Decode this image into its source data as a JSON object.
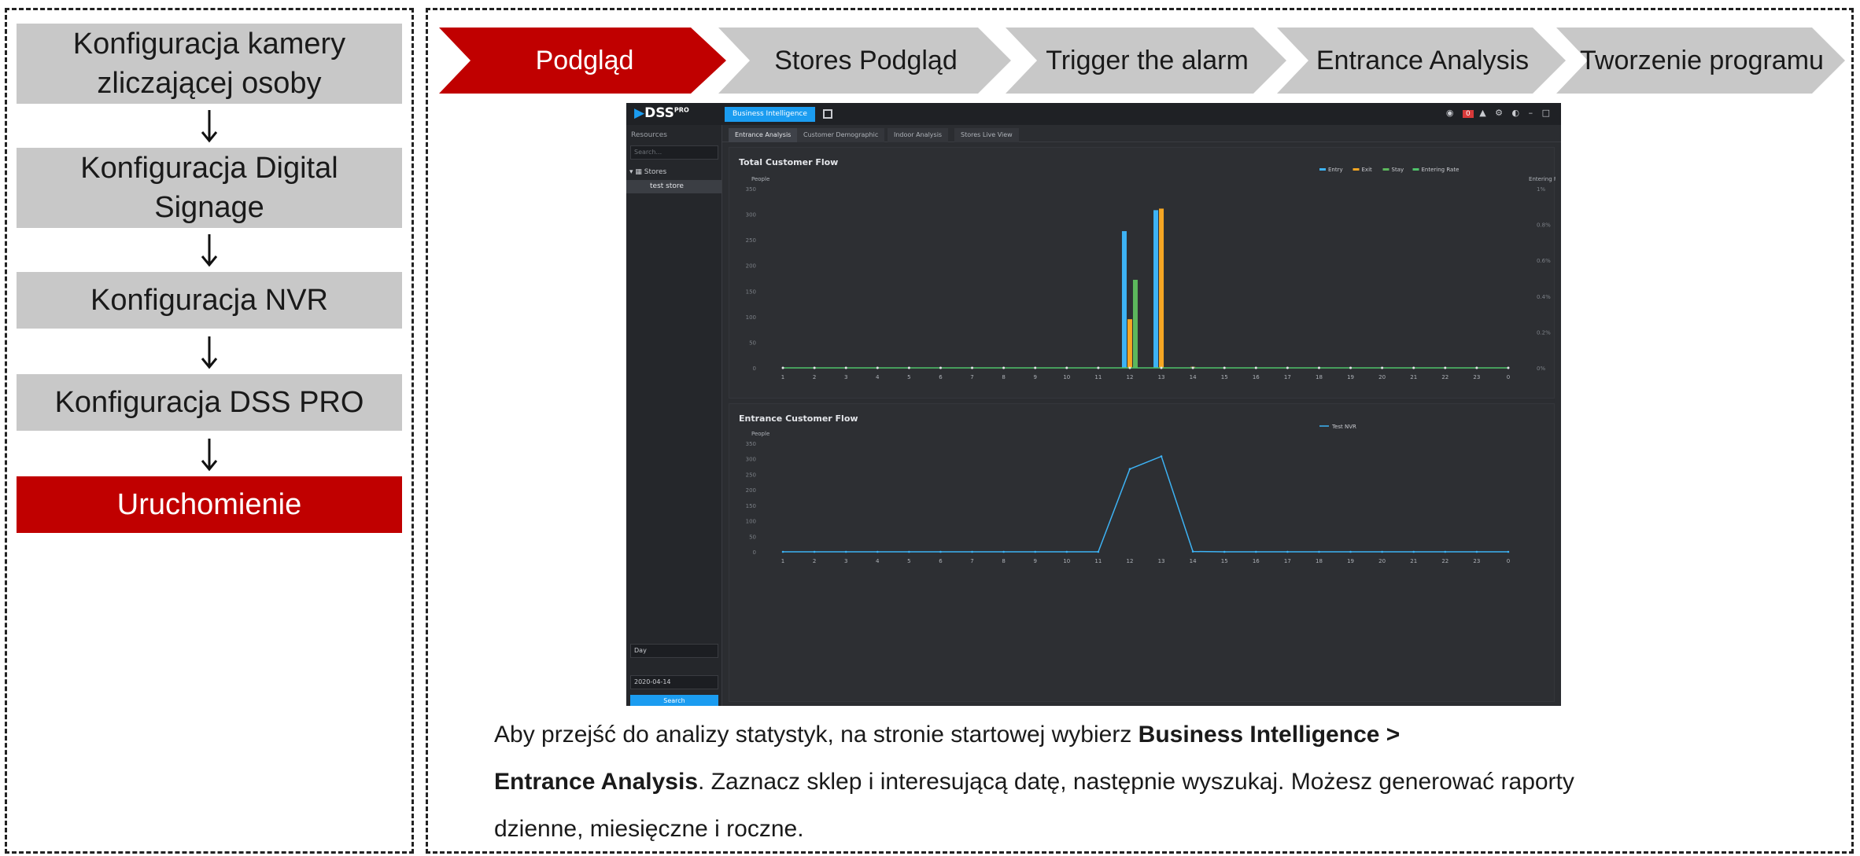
{
  "workflow": {
    "steps": [
      {
        "label": "Konfiguracja kamery\nzliczającej osoby",
        "active": false
      },
      {
        "label": "Konfiguracja Digital\nSignage",
        "active": false
      },
      {
        "label": "Konfiguracja NVR",
        "active": false
      },
      {
        "label": "Konfiguracja DSS PRO",
        "active": false
      },
      {
        "label": "Uruchomienie",
        "active": true
      }
    ],
    "arrow_icon": "arrow-down-icon"
  },
  "process_bar": {
    "tabs": [
      {
        "label": "Podgląd",
        "active": true
      },
      {
        "label": "Stores Podgląd",
        "active": false
      },
      {
        "label": "Trigger the alarm",
        "active": false
      },
      {
        "label": "Entrance Analysis",
        "active": false
      },
      {
        "label": "Tworzenie programu",
        "active": false
      }
    ],
    "active_color": "#c00000",
    "inactive_color": "#c8c8c8"
  },
  "dss": {
    "logo": "DSS",
    "logo_sup": "PRO",
    "app_tab": "Business Intelligence",
    "alarm_badge": "0",
    "sidebar": {
      "resources_label": "Resources",
      "search_placeholder": "Search...",
      "tree_root": "Stores",
      "tree_child": "test store",
      "period_select": "Day",
      "date_value": "2020-04-14",
      "search_button": "Search"
    },
    "tabs": [
      "Entrance Analysis",
      "Customer Demographic",
      "Indoor Analysis",
      "Stores Live View"
    ],
    "accent": "#1b9cf0"
  },
  "chart_data": [
    {
      "type": "bar",
      "title": "Total Customer Flow",
      "ylabel": "People",
      "y2label": "Entering Rate",
      "ylim": [
        0,
        350
      ],
      "yticks": [
        "350",
        "300",
        "250",
        "200",
        "150",
        "100",
        "50",
        "0"
      ],
      "y2ticks": [
        "1%",
        "0.8%",
        "0.6%",
        "0.4%",
        "0.2%",
        "0%"
      ],
      "categories": [
        "1",
        "2",
        "3",
        "4",
        "5",
        "6",
        "7",
        "8",
        "9",
        "10",
        "11",
        "12",
        "13",
        "14",
        "15",
        "16",
        "17",
        "18",
        "19",
        "20",
        "21",
        "22",
        "23",
        "0"
      ],
      "series": [
        {
          "name": "Entry",
          "color": "#3db3f5",
          "values": [
            0,
            0,
            0,
            0,
            0,
            0,
            0,
            0,
            0,
            0,
            0,
            267,
            308,
            0,
            0,
            0,
            0,
            0,
            0,
            0,
            0,
            0,
            0,
            0
          ]
        },
        {
          "name": "Exit",
          "color": "#f5a623",
          "values": [
            0,
            0,
            0,
            0,
            0,
            0,
            0,
            0,
            0,
            0,
            0,
            95,
            311,
            2,
            0,
            0,
            0,
            0,
            0,
            0,
            0,
            0,
            0,
            0
          ]
        },
        {
          "name": "Stay",
          "color": "#5cb85c",
          "values": [
            0,
            0,
            0,
            0,
            0,
            0,
            0,
            0,
            0,
            0,
            0,
            172,
            0,
            0,
            0,
            0,
            0,
            0,
            0,
            0,
            0,
            0,
            0,
            0
          ]
        },
        {
          "name": "Entering Rate",
          "color": "#4fc26a",
          "values": [
            0,
            0,
            0,
            0,
            0,
            0,
            0,
            0,
            0,
            0,
            0,
            0,
            0,
            0,
            0,
            0,
            0,
            0,
            0,
            0,
            0,
            0,
            0,
            0
          ]
        }
      ]
    },
    {
      "type": "line",
      "title": "Entrance Customer Flow",
      "ylabel": "People",
      "ylim": [
        0,
        350
      ],
      "yticks": [
        "350",
        "300",
        "250",
        "200",
        "150",
        "100",
        "50",
        "0"
      ],
      "categories": [
        "1",
        "2",
        "3",
        "4",
        "5",
        "6",
        "7",
        "8",
        "9",
        "10",
        "11",
        "12",
        "13",
        "14",
        "15",
        "16",
        "17",
        "18",
        "19",
        "20",
        "21",
        "22",
        "23",
        "0"
      ],
      "series": [
        {
          "name": "Test NVR",
          "color": "#3db3f5",
          "values": [
            0,
            0,
            0,
            0,
            0,
            0,
            0,
            0,
            0,
            0,
            0,
            267,
            308,
            1,
            0,
            0,
            0,
            0,
            0,
            0,
            0,
            0,
            0,
            0
          ]
        }
      ]
    }
  ],
  "description": {
    "line1_plain": "Aby przejść do analizy statystyk, na stronie startowej wybierz ",
    "line1_bold": "Business Intelligence >",
    "line2_bold": "Entrance Analysis",
    "line2_plain": ". Zaznacz sklep i interesującą datę, następnie wyszukaj. Możesz generować raporty",
    "line3_plain": "dzienne, miesięczne i roczne."
  }
}
